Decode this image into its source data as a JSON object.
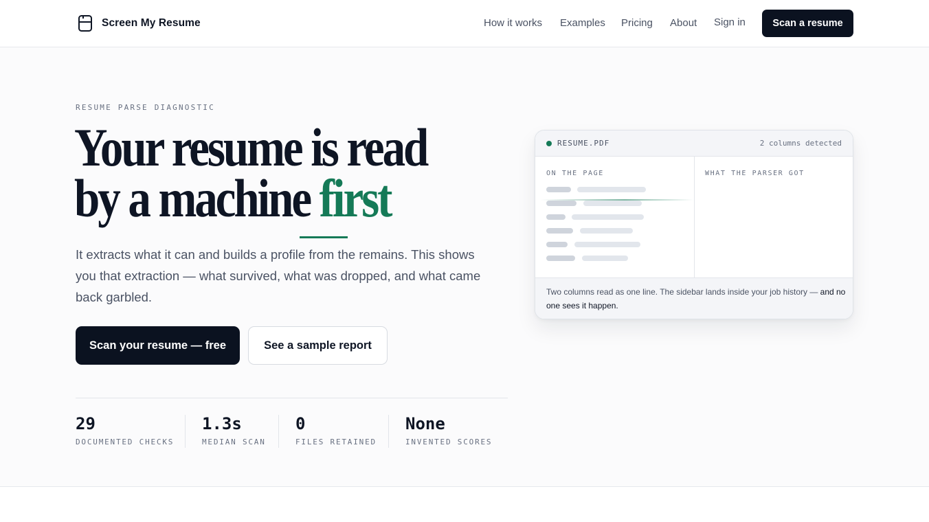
{
  "header": {
    "brand": "Screen My Resume",
    "nav": [
      {
        "label": "How it works"
      },
      {
        "label": "Examples"
      },
      {
        "label": "Pricing"
      },
      {
        "label": "About"
      },
      {
        "label": "Sign in"
      }
    ],
    "cta": "Scan a resume"
  },
  "hero": {
    "eyebrow": "RESUME PARSE DIAGNOSTIC",
    "headline_line1": "Your resume is read",
    "headline_line2_start": "by a machine ",
    "headline_accent": "first",
    "lede": "It extracts what it can and builds a profile from the remains. This shows you that extraction — what survived, what was dropped, and what came back garbled.",
    "primary_button": "Scan your resume — free",
    "secondary_button": "See a sample report"
  },
  "stats": [
    {
      "value": "29",
      "label": "DOCUMENTED CHECKS"
    },
    {
      "value": "1.3s",
      "label": "MEDIAN SCAN"
    },
    {
      "value": "0",
      "label": "FILES RETAINED"
    },
    {
      "value": "None",
      "label": "INVENTED SCORES"
    }
  ],
  "card": {
    "file": "RESUME.PDF",
    "status": "2 columns detected",
    "left_title": "ON THE PAGE",
    "right_title": "WHAT THE PARSER GOT",
    "caption_main": "Two columns read as one line. The sidebar lands inside your job history — ",
    "caption_strong": "and no one sees it happen."
  },
  "colors": {
    "accent": "#157a57",
    "ink": "#0e1524",
    "button_dark": "#0b1220",
    "muted": "#4a5263"
  }
}
